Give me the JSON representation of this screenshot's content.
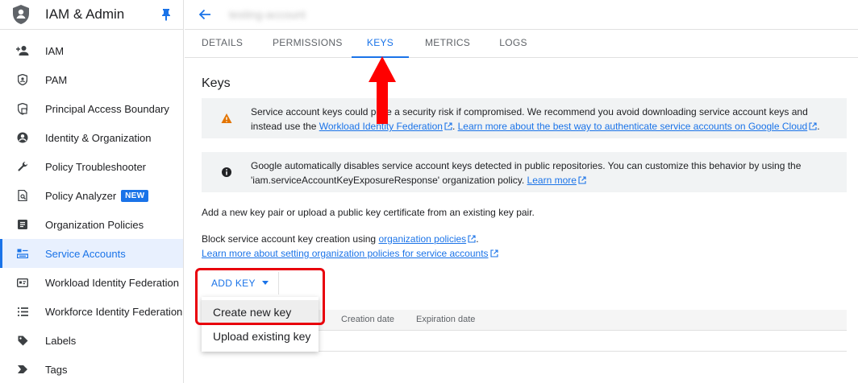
{
  "app": {
    "title": "IAM & Admin"
  },
  "sidebar": {
    "items": [
      {
        "label": "IAM",
        "icon": "person-add-icon"
      },
      {
        "label": "PAM",
        "icon": "shield-icon"
      },
      {
        "label": "Principal Access Boundary",
        "icon": "boundary-icon"
      },
      {
        "label": "Identity & Organization",
        "icon": "account-circle-icon"
      },
      {
        "label": "Policy Troubleshooter",
        "icon": "wrench-icon"
      },
      {
        "label": "Policy Analyzer",
        "icon": "analyzer-icon",
        "badge": "NEW"
      },
      {
        "label": "Organization Policies",
        "icon": "policy-doc-icon"
      },
      {
        "label": "Service Accounts",
        "icon": "service-account-icon",
        "active": true
      },
      {
        "label": "Workload Identity Federation",
        "icon": "id-card-icon"
      },
      {
        "label": "Workforce Identity Federation",
        "icon": "list-icon"
      },
      {
        "label": "Labels",
        "icon": "label-icon"
      },
      {
        "label": "Tags",
        "icon": "tag-icon"
      }
    ]
  },
  "header": {
    "account_name": "testing-account"
  },
  "tabs": [
    {
      "label": "DETAILS"
    },
    {
      "label": "PERMISSIONS"
    },
    {
      "label": "KEYS",
      "active": true
    },
    {
      "label": "METRICS"
    },
    {
      "label": "LOGS"
    }
  ],
  "main": {
    "heading": "Keys",
    "warning": {
      "text_1": "Service account keys could pose a security risk if compromised. We recommend you avoid downloading service account keys and instead use the ",
      "link_1": "Workload Identity Federation",
      "text_2": ". ",
      "link_2": "Learn more about the best way to authenticate service accounts on Google Cloud",
      "text_3": "."
    },
    "info": {
      "text_1": "Google automatically disables service account keys detected in public repositories. You can customize this behavior by using the 'iam.serviceAccountKeyExposureResponse' organization policy. ",
      "link_1": "Learn more"
    },
    "add_key_text": "Add a new key pair or upload a public key certificate from an existing key pair.",
    "block_text": "Block service account key creation using ",
    "block_link": "organization policies",
    "block_suffix": ".",
    "learn_more_link": "Learn more about setting organization policies for service accounts",
    "add_key_button": "ADD KEY",
    "table_headers": [
      "Creation date",
      "Expiration date"
    ],
    "menu_items": [
      "Create new key",
      "Upload existing key"
    ]
  },
  "colors": {
    "accent": "#1a73e8",
    "annotation_red": "#e8000b",
    "warning_orange": "#e37400"
  }
}
